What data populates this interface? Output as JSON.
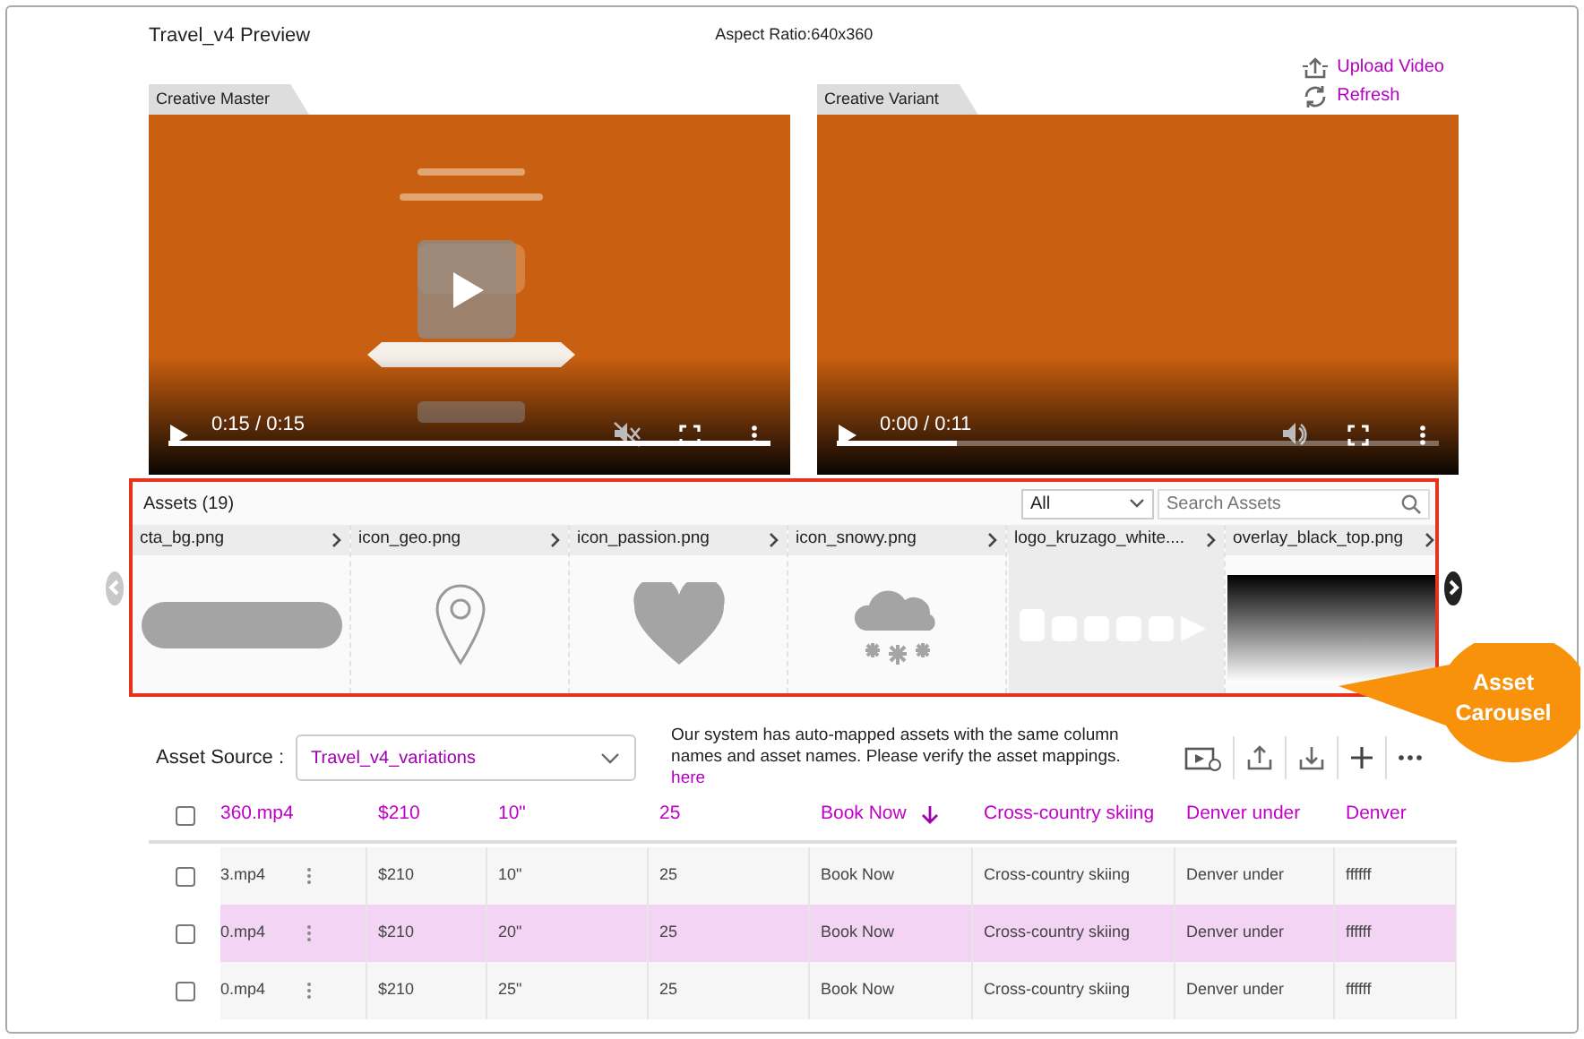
{
  "header": {
    "title": "Travel_v4 Preview",
    "aspect_ratio": "Aspect Ratio:640x360"
  },
  "actions": [
    {
      "kind": "upload",
      "label": "Upload Video"
    },
    {
      "kind": "refresh",
      "label": "Refresh"
    }
  ],
  "players": [
    {
      "tab": "Creative Master",
      "time": "0:15 / 0:15",
      "level": 1,
      "muted": true,
      "play_overlay": true
    },
    {
      "tab": "Creative Variant",
      "time": "0:00 / 0:11",
      "level": 0.2,
      "muted": false,
      "play_overlay": false
    }
  ],
  "assets": {
    "title": "Assets (19)",
    "filter": "All",
    "search_placeholder": "Search Assets",
    "items": [
      {
        "name": "cta_bg.png",
        "kind": "pill"
      },
      {
        "name": "icon_geo.png",
        "kind": "pin"
      },
      {
        "name": "icon_passion.png",
        "kind": "heart"
      },
      {
        "name": "icon_snowy.png",
        "kind": "snow"
      },
      {
        "name": "logo_kruzago_white....",
        "kind": "logo"
      },
      {
        "name": "overlay_black_top.png",
        "kind": "gradient"
      }
    ]
  },
  "callout": "Asset Carousel",
  "asset_source": {
    "label": "Asset Source :",
    "value": "Travel_v4_variations",
    "note": "Our system has auto-mapped assets with the same column names and asset names. Please verify the asset mappings.",
    "link": "here"
  },
  "toolbar": [
    {
      "kind": "video-link"
    },
    {
      "kind": "upload"
    },
    {
      "kind": "download"
    },
    {
      "kind": "add"
    },
    {
      "kind": "more"
    }
  ],
  "table": {
    "all_checked": false,
    "columns": [
      {
        "label": "360.mp4",
        "sorted": false
      },
      {
        "label": "$210",
        "sorted": false
      },
      {
        "label": "10\"",
        "sorted": false
      },
      {
        "label": "25",
        "sorted": false
      },
      {
        "label": "Book Now",
        "sorted": true
      },
      {
        "label": "Cross-country skiing",
        "sorted": false
      },
      {
        "label": "Denver under",
        "sorted": false
      },
      {
        "label": "Denver",
        "sorted": false
      }
    ],
    "rows": [
      {
        "selected": false,
        "checked": false,
        "cells": [
          "3.mp4",
          "$210",
          "10\"",
          "25",
          "Book Now",
          "Cross-country skiing",
          "Denver under",
          "ffffff"
        ]
      },
      {
        "selected": true,
        "checked": false,
        "cells": [
          "0.mp4",
          "$210",
          "20\"",
          "25",
          "Book Now",
          "Cross-country skiing",
          "Denver under",
          "ffffff"
        ]
      },
      {
        "selected": false,
        "checked": false,
        "cells": [
          "0.mp4",
          "$210",
          "25\"",
          "25",
          "Book Now",
          "Cross-country skiing",
          "Denver under",
          "ffffff"
        ]
      }
    ]
  }
}
